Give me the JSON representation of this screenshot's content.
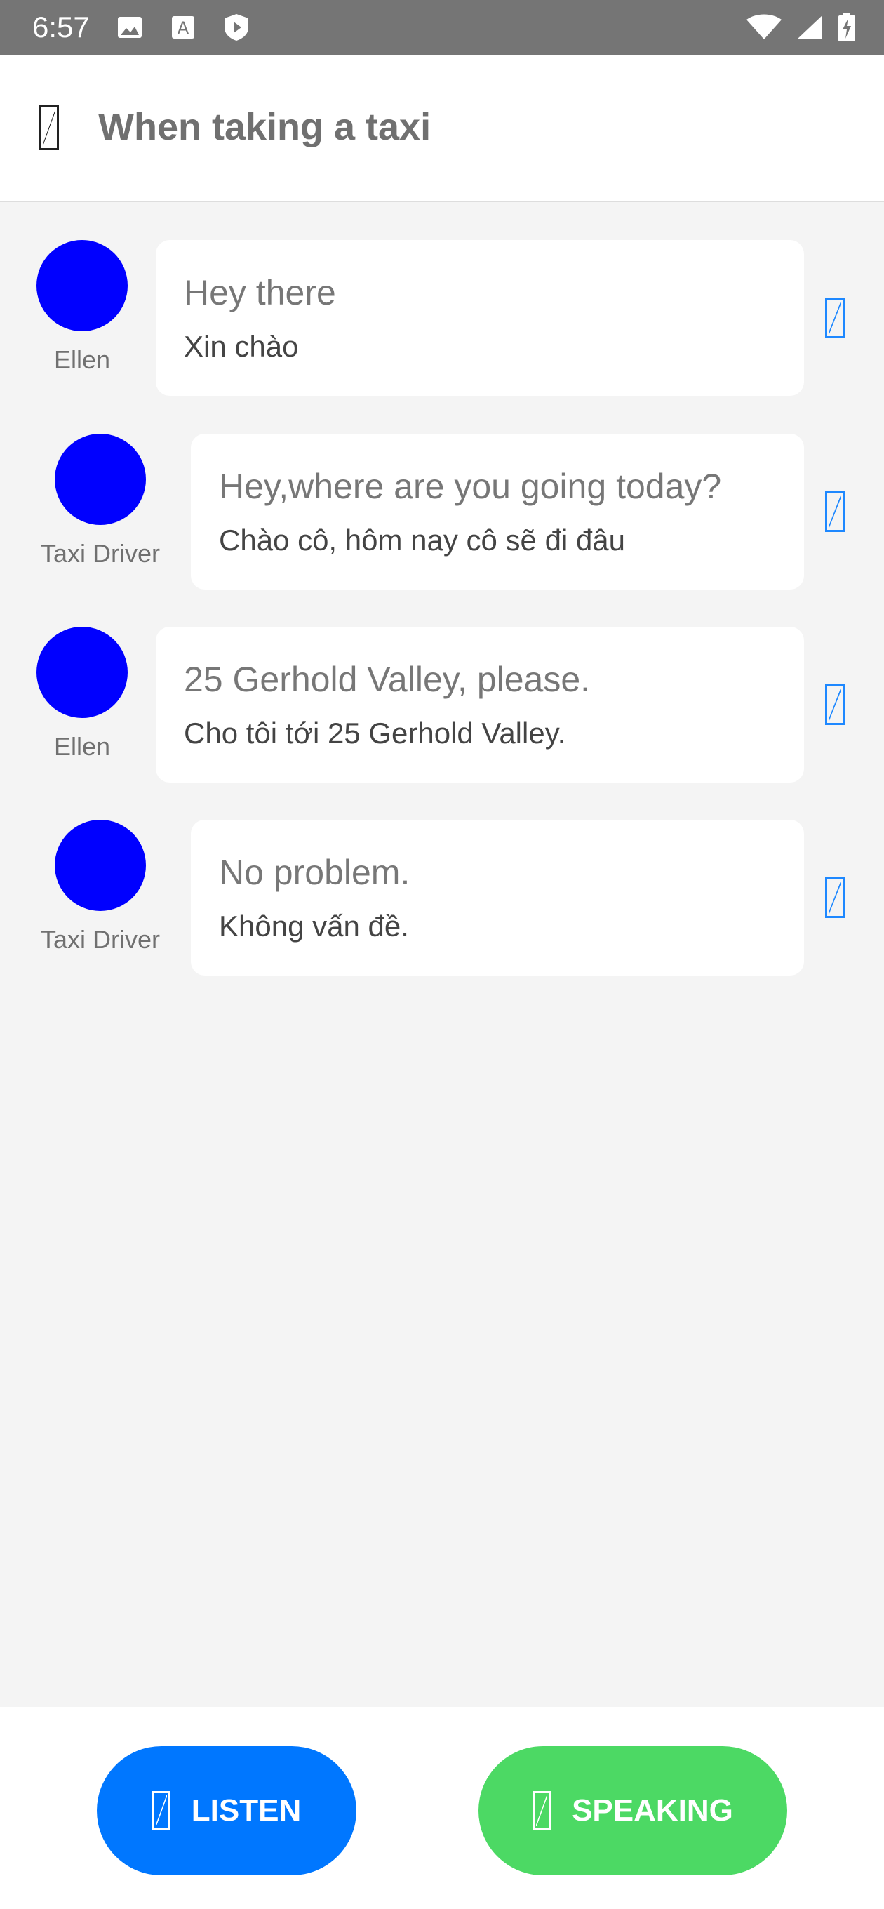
{
  "status_bar": {
    "time": "6:57",
    "icons_left": [
      "image-icon",
      "keyboard-a-icon",
      "shield-play-icon"
    ],
    "icons_right": [
      "wifi-icon",
      "cell-signal-icon",
      "battery-charging-icon"
    ]
  },
  "app_bar": {
    "back_icon": "back-icon",
    "title": "When taking a taxi"
  },
  "conversation": [
    {
      "speaker": "Ellen",
      "english": "Hey there",
      "vietnamese": "Xin chào"
    },
    {
      "speaker": "Taxi Driver",
      "english": "Hey,where are you going today?",
      "vietnamese": "Chào cô, hôm nay cô sẽ đi đâu"
    },
    {
      "speaker": "Ellen",
      "english": "25 Gerhold Valley, please.",
      "vietnamese": "Cho tôi tới 25 Gerhold Valley."
    },
    {
      "speaker": "Taxi Driver",
      "english": "No problem.",
      "vietnamese": "Không vấn đề."
    }
  ],
  "bottom_bar": {
    "listen_label": "LISTEN",
    "speaking_label": "SPEAKING"
  },
  "colors": {
    "status_bar": "#757575",
    "avatar": "#0000ff",
    "listen_button": "#0077ff",
    "speaking_button": "#4cd964",
    "speaker_icon": "#1e88ff"
  }
}
